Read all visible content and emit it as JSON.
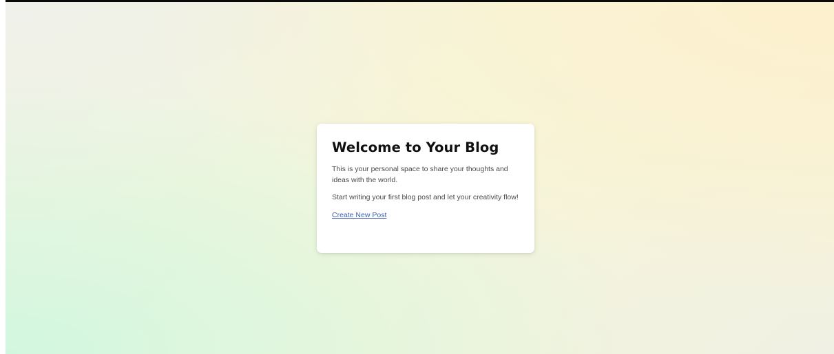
{
  "card": {
    "title": "Welcome to Your Blog",
    "intro": "This is your personal space to share your thoughts and ideas with the world.",
    "prompt": "Start writing your first blog post and let your creativity flow!",
    "link_label": "Create New Post"
  },
  "colors": {
    "link": "#3d5fa8",
    "title": "#111111",
    "body_text": "#4a4a4a",
    "card_background": "#ffffff",
    "top_bar": "#0a0a0a"
  }
}
